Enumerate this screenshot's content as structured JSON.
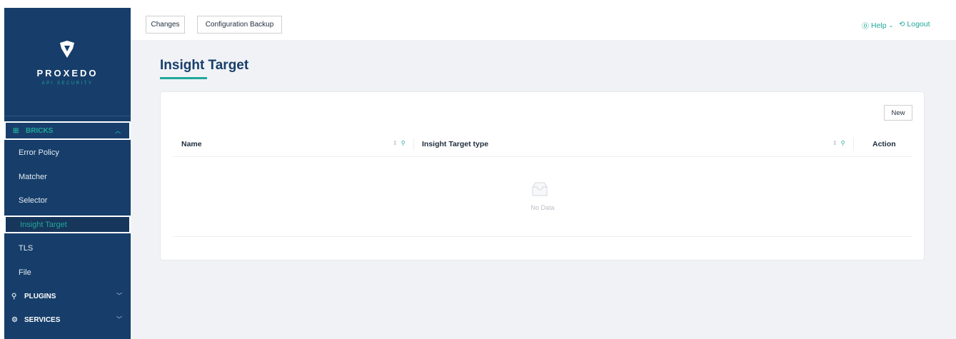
{
  "brand": {
    "name": "PROXEDO",
    "tagline": "API SECURITY"
  },
  "topbar": {
    "changes_label": "Changes",
    "backup_label": "Configuration Backup",
    "help_label": "Help",
    "logout_label": "Logout"
  },
  "sidebar": {
    "bricks_label": "BRICKS",
    "items": [
      {
        "label": "Error Policy"
      },
      {
        "label": "Matcher"
      },
      {
        "label": "Selector"
      },
      {
        "label": "Insight Target"
      },
      {
        "label": "TLS"
      },
      {
        "label": "File"
      }
    ],
    "plugins_label": "PLUGINS",
    "services_label": "SERVICES"
  },
  "page": {
    "title": "Insight Target"
  },
  "table": {
    "new_label": "New",
    "columns": [
      {
        "label": "Name"
      },
      {
        "label": "Insight Target type"
      },
      {
        "label": "Action"
      }
    ],
    "empty_text": "No Data"
  },
  "colors": {
    "sidebar": "#173e6a",
    "accent": "#1fa89a",
    "background": "#f0f2f5"
  },
  "icons": [
    "logo-icon",
    "grid-icon",
    "chevron-up-icon",
    "chevron-down-icon",
    "plug-icon",
    "gear-icon",
    "help-circle-icon",
    "logout-icon",
    "sort-icon",
    "search-icon",
    "empty-inbox-icon"
  ]
}
